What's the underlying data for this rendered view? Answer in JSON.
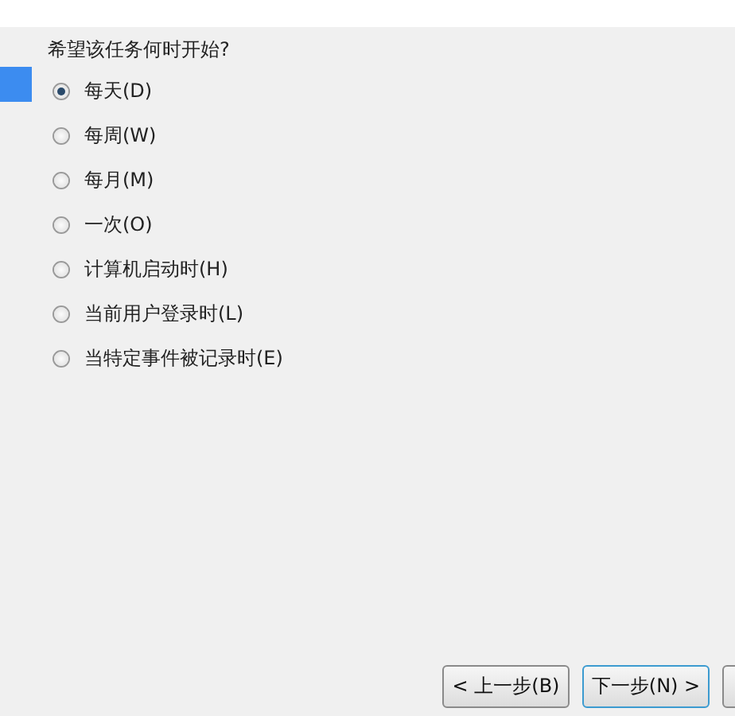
{
  "question": "希望该任务何时开始?",
  "options": [
    {
      "label": "每天(D)",
      "selected": true
    },
    {
      "label": "每周(W)",
      "selected": false
    },
    {
      "label": "每月(M)",
      "selected": false
    },
    {
      "label": "一次(O)",
      "selected": false
    },
    {
      "label": "计算机启动时(H)",
      "selected": false
    },
    {
      "label": "当前用户登录时(L)",
      "selected": false
    },
    {
      "label": "当特定事件被记录时(E)",
      "selected": false
    }
  ],
  "buttons": [
    {
      "label": "< 上一步(B)",
      "focused": false
    },
    {
      "label": "下一步(N) >",
      "focused": true
    }
  ]
}
